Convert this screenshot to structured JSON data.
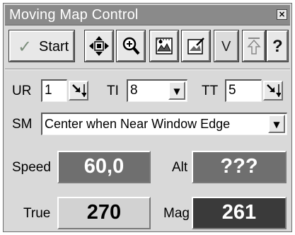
{
  "window": {
    "title": "Moving Map Control",
    "close_glyph": "×"
  },
  "toolbar": {
    "start_label": "Start",
    "start_icon": "check-icon",
    "v_label": "V",
    "q_label": "?"
  },
  "fields": {
    "ur_label": "UR",
    "ur_value": "1",
    "ti_label": "TI",
    "ti_value": "8",
    "tt_label": "TT",
    "tt_value": "5",
    "sm_label": "SM",
    "sm_value": "Center when Near Window Edge"
  },
  "readouts": {
    "speed_label": "Speed",
    "speed_value": "60,0",
    "alt_label": "Alt",
    "alt_value": "???",
    "true_label": "True",
    "true_value": "270",
    "mag_label": "Mag",
    "mag_value": "261"
  },
  "colors": {
    "speed_bg": "#6f6f6f",
    "speed_fg": "#ffffff",
    "alt_bg": "#6f6f6f",
    "alt_fg": "#ffffff",
    "true_bg": "#d2d2d2",
    "true_fg": "#000000",
    "mag_bg": "#3a3a3a",
    "mag_fg": "#ffffff"
  }
}
